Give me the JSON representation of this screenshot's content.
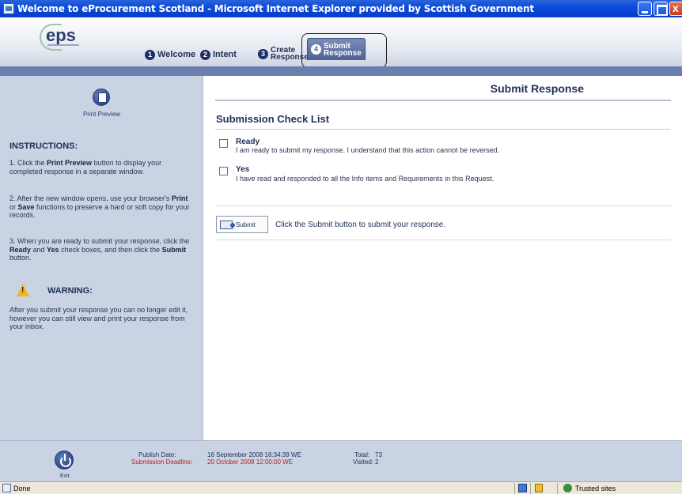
{
  "window": {
    "title": "Welcome to eProcurement Scotland - Microsoft Internet Explorer provided by Scottish Government"
  },
  "header": {
    "logo_text": "eps",
    "tabs": [
      {
        "num": "1",
        "label": "Welcome"
      },
      {
        "num": "2",
        "label": "Intent"
      },
      {
        "num": "3",
        "label_line1": "Create",
        "label_line2": "Response"
      },
      {
        "num": "4",
        "label_line1": "Submit",
        "label_line2": "Response",
        "active": true
      }
    ]
  },
  "sidebar": {
    "print_preview_label": "Print Preview",
    "instructions_title": "INSTRUCTIONS:",
    "instructions": {
      "i1_pre": "1. Click the ",
      "i1_bold": "Print Preview",
      "i1_post": " button to display your completed response in a separate window.",
      "i2_pre": "2. After the new window opens, use your browser's ",
      "i2_b1": "Print",
      "i2_mid": " or ",
      "i2_b2": "Save",
      "i2_post": " functions to preserve a hard or soft copy for your records.",
      "i3_pre": "3. When you are ready to submit your response, click the ",
      "i3_b1": "Ready",
      "i3_mid1": " and ",
      "i3_b2": "Yes",
      "i3_mid2": " check boxes, and then click the ",
      "i3_b3": "Submit",
      "i3_post": " button."
    },
    "warning_title": "WARNING:",
    "warning_text": "After you submit your response you can no longer edit it, however you can still view and print your response from your inbox."
  },
  "main": {
    "page_title": "Submit Response",
    "section_title": "Submission Check List",
    "checks": [
      {
        "title": "Ready",
        "desc": "I am ready to submit my response. I understand that this action cannot be reversed."
      },
      {
        "title": "Yes",
        "desc": "I have read and responded to all the Info items and Requirements in this Request."
      }
    ],
    "submit_button": "Submit",
    "submit_hint": "Click the Submit button to submit your response."
  },
  "footer": {
    "exit_label": "Exit",
    "publish_date_label": "Publish Date:",
    "publish_date_value": "16 September 2008 16:34:39 WE",
    "deadline_label": "Submission Deadline:",
    "deadline_value": "20 October 2008 12:00:00 WE",
    "total_label": "Total:",
    "total_value": "73",
    "visited_label": "Visited:",
    "visited_value": "2"
  },
  "statusbar": {
    "status": "Done",
    "zone": "Trusted sites"
  }
}
